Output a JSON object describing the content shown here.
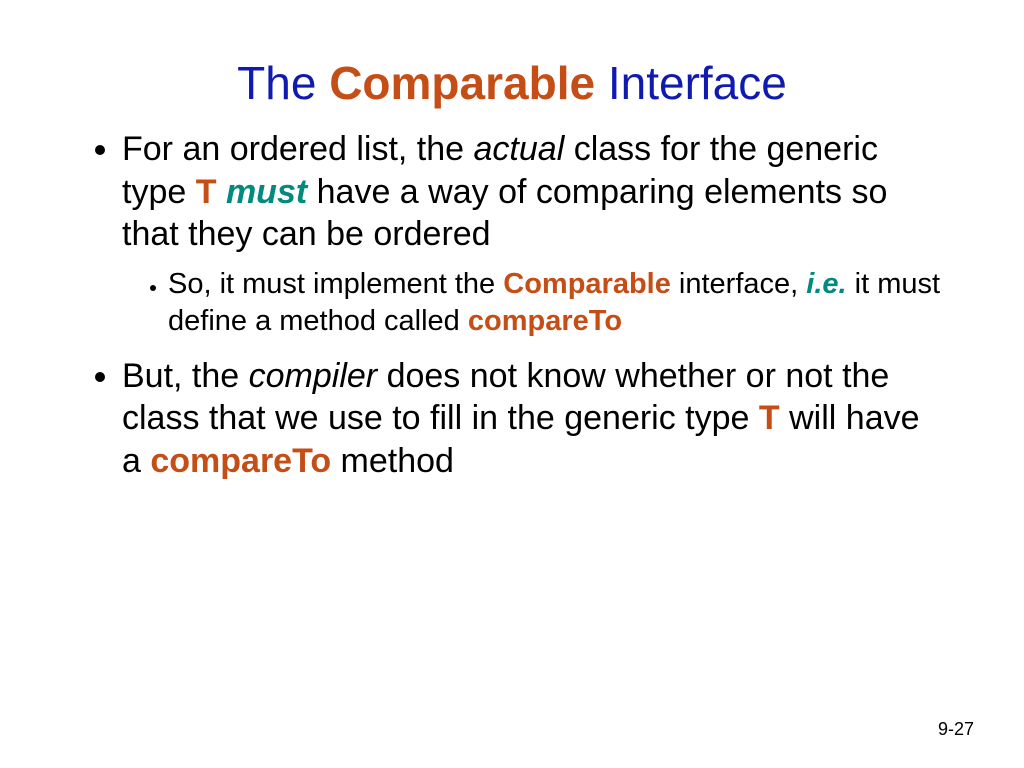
{
  "title": {
    "w1": "The ",
    "w2": "Comparable",
    "w3": " Interface"
  },
  "b1": {
    "t1": "For an ordered list, the ",
    "t2": "actual",
    "t3": " class for the generic type ",
    "t4": "T",
    "t5": " ",
    "t6": "must",
    "t7": " have a way of comparing elements so that they can be ordered"
  },
  "s1": {
    "t1": "So, it must implement the ",
    "t2": "Comparable",
    "t3": " interface, ",
    "t4": "i.e.",
    "t5": " it must define a method called ",
    "t6": "compareTo"
  },
  "b2": {
    "t1": "But, the ",
    "t2": "compiler",
    "t3": " does not know whether or not the class that we use to fill in the generic type ",
    "t4": "T",
    "t5": " will have a ",
    "t6": "compareTo",
    "t7": " method"
  },
  "page": "9-27"
}
